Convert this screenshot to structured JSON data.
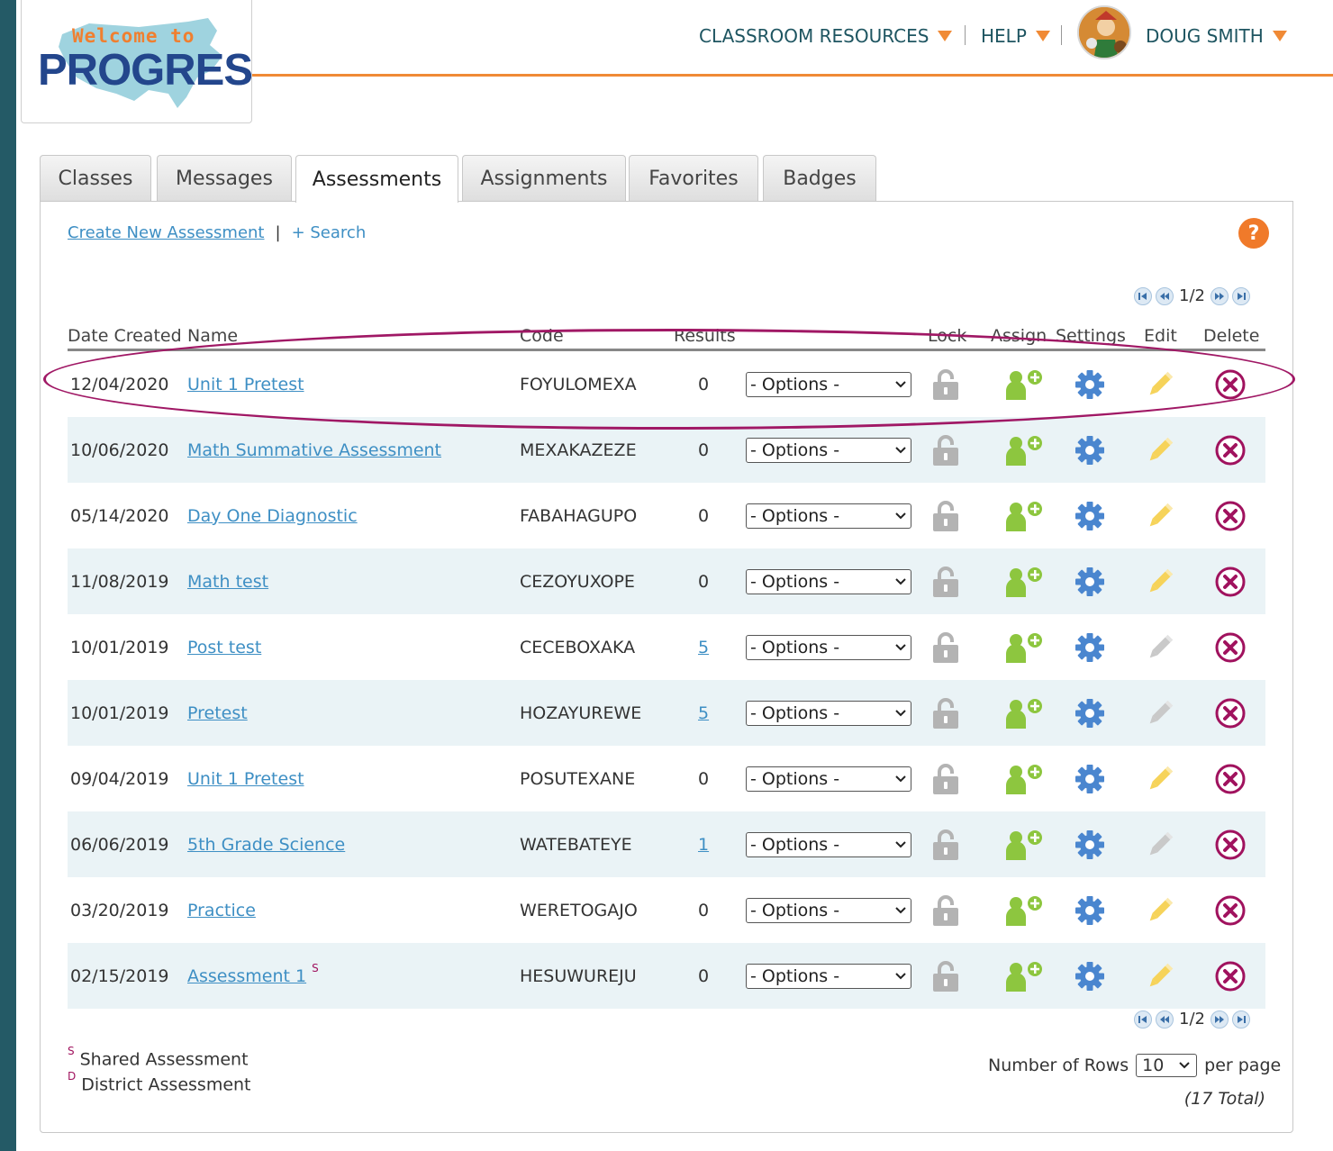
{
  "logo": {
    "welcome": "Welcome to",
    "progress": "PROGRESS"
  },
  "topnav": {
    "classroom_resources": "CLASSROOM RESOURCES",
    "help": "HELP",
    "user_name": "DOUG SMITH"
  },
  "tabs": [
    "Classes",
    "Messages",
    "Assessments",
    "Assignments",
    "Favorites",
    "Badges"
  ],
  "active_tab": "Assessments",
  "toolbar": {
    "create": "Create New Assessment",
    "separator": "|",
    "search": "+ Search",
    "help_icon": "?"
  },
  "pager": {
    "label": "1/2"
  },
  "columns": {
    "date": "Date Created",
    "name": "Name",
    "code": "Code",
    "results": "Results",
    "lock": "Lock",
    "assign": "Assign",
    "settings": "Settings",
    "edit": "Edit",
    "delete": "Delete"
  },
  "options_label": "- Options -",
  "rows": [
    {
      "date": "12/04/2020",
      "name": "Unit 1 Pretest",
      "code": "FOYULOMEXA",
      "results": "0"
    },
    {
      "date": "10/06/2020",
      "name": "Math Summative Assessment",
      "code": "MEXAKAZEZE",
      "results": "0"
    },
    {
      "date": "05/14/2020",
      "name": "Day One Diagnostic",
      "code": "FABAHAGUPO",
      "results": "0"
    },
    {
      "date": "11/08/2019",
      "name": "Math test",
      "code": "CEZOYUXOPE",
      "results": "0"
    },
    {
      "date": "10/01/2019",
      "name": "Post test",
      "code": "CECEBOXAKA",
      "results": "5"
    },
    {
      "date": "10/01/2019",
      "name": "Pretest",
      "code": "HOZAYUREWE",
      "results": "5"
    },
    {
      "date": "09/04/2019",
      "name": "Unit 1 Pretest",
      "code": "POSUTEXANE",
      "results": "0"
    },
    {
      "date": "06/06/2019",
      "name": "5th Grade Science",
      "code": "WATEBATEYE",
      "results": "1"
    },
    {
      "date": "03/20/2019",
      "name": "Practice",
      "code": "WERETOGAJO",
      "results": "0"
    },
    {
      "date": "02/15/2019",
      "name": "Assessment 1",
      "code": "HESUWUREJU",
      "results": "0",
      "shared_mark": "S"
    }
  ],
  "legend": {
    "shared_mark": "S",
    "shared": "Shared Assessment",
    "district_mark": "D",
    "district": "District Assessment"
  },
  "rows_control": {
    "label": "Number of Rows",
    "value": "10",
    "suffix": "per page"
  },
  "total": "(17 Total)",
  "colors": {
    "accent_orange": "#f08a35",
    "nav_teal": "#1e5561",
    "link_blue": "#3e8fc4",
    "assign_green": "#8dc63f",
    "settings_blue": "#4a86cf",
    "delete_magenta": "#a0125e",
    "highlight_magenta": "#a01865"
  },
  "icons": {
    "lock": "lock-open-icon",
    "assign": "user-add-icon",
    "settings": "gear-icon",
    "edit": "pencil-icon",
    "delete": "close-circle-icon"
  }
}
